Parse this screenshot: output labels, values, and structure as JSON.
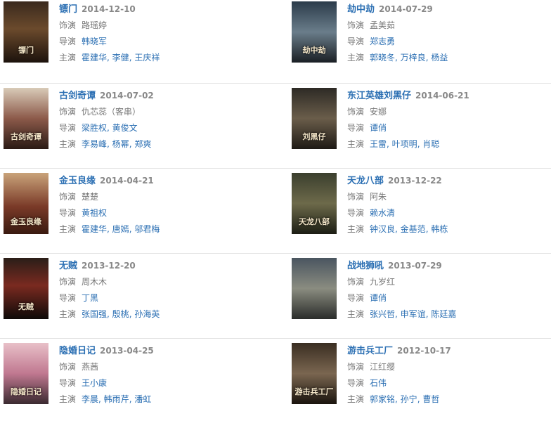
{
  "labels": {
    "role": "饰演",
    "director": "导演",
    "cast": "主演"
  },
  "items": [
    {
      "title": "镖门",
      "date": "2014-12-10",
      "role": "路瑶婷",
      "director": "韩晓军",
      "cast": [
        "霍建华",
        "李健",
        "王庆祥"
      ],
      "poster_text": "镖门"
    },
    {
      "title": "劫中劫",
      "date": "2014-07-29",
      "role": "孟美茹",
      "director": "郑志勇",
      "cast": [
        "郭晓冬",
        "万梓良",
        "杨益"
      ],
      "poster_text": "劫中劫"
    },
    {
      "title": "古剑奇谭",
      "date": "2014-07-02",
      "role": "仇芯蕊（客串）",
      "director": "梁胜权, 黄俊文",
      "directors": [
        "梁胜权",
        "黄俊文"
      ],
      "cast": [
        "李易峰",
        "杨幂",
        "郑爽"
      ],
      "poster_text": "古剑奇谭"
    },
    {
      "title": "东江英雄刘黑仔",
      "date": "2014-06-21",
      "role": "安娜",
      "director": "谭俏",
      "cast": [
        "王雷",
        "叶项明",
        "肖聪"
      ],
      "poster_text": "刘黑仔"
    },
    {
      "title": "金玉良缘",
      "date": "2014-04-21",
      "role": "楚楚",
      "director": "黄祖权",
      "cast": [
        "霍建华",
        "唐嫣",
        "邬君梅"
      ],
      "poster_text": "金玉良缘"
    },
    {
      "title": "天龙八部",
      "date": "2013-12-22",
      "role": "阿朱",
      "director": "赖水清",
      "cast": [
        "钟汉良",
        "金基范",
        "韩栋"
      ],
      "poster_text": "天龙八部"
    },
    {
      "title": "无贼",
      "date": "2013-12-20",
      "role": "周木木",
      "director": "丁黑",
      "cast": [
        "张国强",
        "殷桃",
        "孙海英"
      ],
      "poster_text": "无贼"
    },
    {
      "title": "战地狮吼",
      "date": "2013-07-29",
      "role": "九岁红",
      "director": "谭俏",
      "cast": [
        "张兴哲",
        "申军谊",
        "陈廷嘉"
      ],
      "poster_text": ""
    },
    {
      "title": "隐婚日记",
      "date": "2013-04-25",
      "role": "燕茜",
      "director": "王小康",
      "cast": [
        "李晨",
        "韩雨芹",
        "潘虹"
      ],
      "poster_text": "隐婚日记"
    },
    {
      "title": "游击兵工厂",
      "date": "2012-10-17",
      "role": "江红缨",
      "director": "石伟",
      "cast": [
        "郭家铭",
        "孙宁",
        "曹哲"
      ],
      "poster_text": "游击兵工厂"
    }
  ],
  "colors": {
    "link": "#2b6fb3",
    "text": "#777777",
    "date": "#888888",
    "divider": "#e3e3e3"
  }
}
